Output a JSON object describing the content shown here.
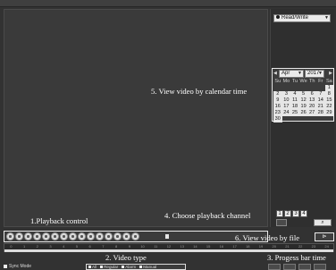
{
  "right_panel": {
    "mode_select": "Read/Write"
  },
  "calendar": {
    "month": "Apr",
    "year": "2017",
    "weekdays": [
      "Su",
      "Mo",
      "Tu",
      "We",
      "Th",
      "Fr",
      "Sa"
    ],
    "weeks": [
      [
        "",
        "",
        "",
        "",
        "",
        "",
        "1"
      ],
      [
        "2",
        "3",
        "4",
        "5",
        "6",
        "7",
        "8"
      ],
      [
        "9",
        "10",
        "11",
        "12",
        "13",
        "14",
        "15"
      ],
      [
        "16",
        "17",
        "18",
        "19",
        "20",
        "21",
        "22"
      ],
      [
        "23",
        "24",
        "25",
        "26",
        "27",
        "28",
        "29"
      ],
      [
        "30",
        "",
        "",
        "",
        "",
        "",
        ""
      ]
    ]
  },
  "channels": [
    "1",
    "2",
    "3",
    "4"
  ],
  "controls": {
    "button_count": 15
  },
  "timeline": {
    "hours": [
      "0",
      "1",
      "2",
      "3",
      "4",
      "5",
      "6",
      "7",
      "8",
      "9",
      "10",
      "11",
      "12",
      "13",
      "14",
      "15",
      "16",
      "17",
      "18",
      "19",
      "20",
      "21",
      "22",
      "23",
      "24"
    ]
  },
  "bottom": {
    "sync_label": "Sync Mode",
    "video_types": [
      "All",
      "Regular",
      "Alarm",
      "Manual"
    ]
  },
  "callouts": {
    "c1": "1.Playback control",
    "c2": "2. Video type",
    "c3": "3. Progess bar time",
    "c4": "4. Choose playback channel",
    "c5": "5. View video by calendar time",
    "c6": "6. View video by file"
  }
}
